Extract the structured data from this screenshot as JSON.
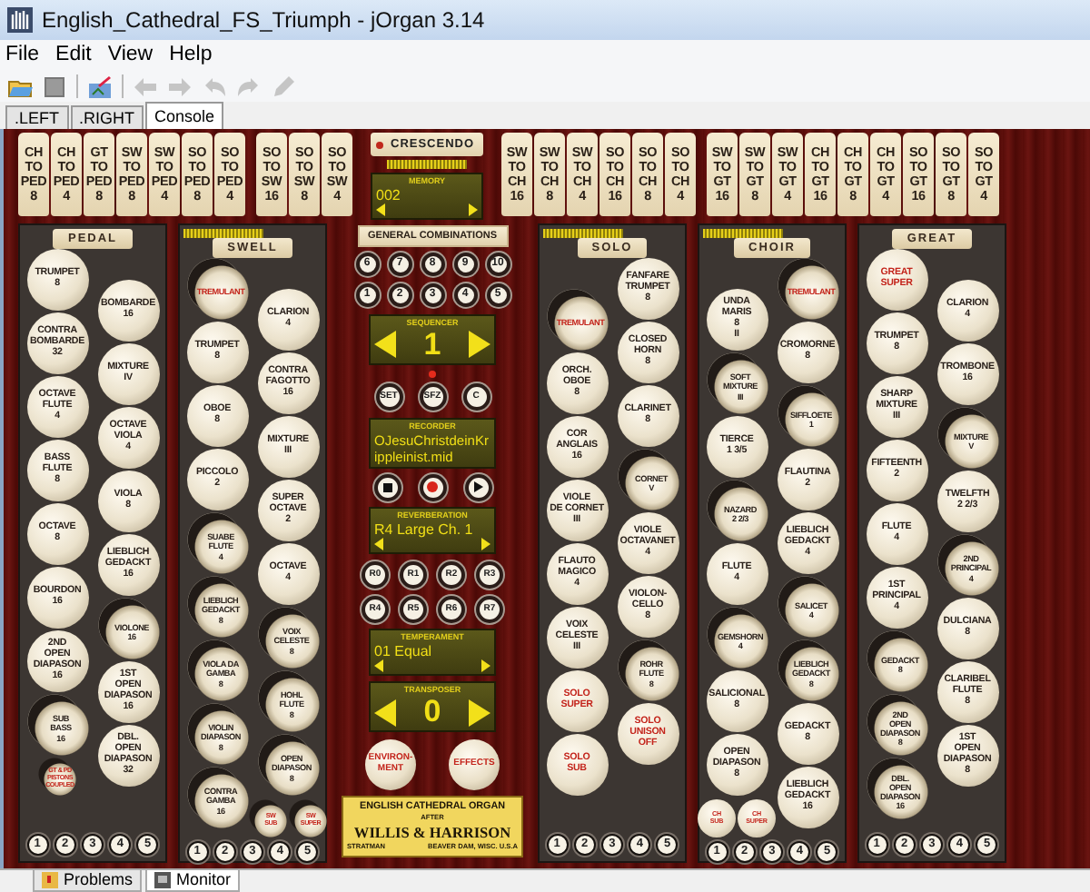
{
  "window": {
    "title": "English_Cathedral_FS_Triumph - jOrgan 3.14"
  },
  "menu": [
    "File",
    "Edit",
    "View",
    "Help"
  ],
  "toolbar": [
    {
      "disabled": false
    },
    {
      "disabled": false
    },
    {
      "disabled": false
    },
    {
      "disabled": true
    },
    {
      "disabled": true
    },
    {
      "disabled": true
    },
    {
      "disabled": true
    },
    {
      "disabled": true
    }
  ],
  "tabs": [
    {
      "label": ".LEFT",
      "selected": false
    },
    {
      "label": ".RIGHT",
      "selected": false
    },
    {
      "label": "Console",
      "selected": true
    }
  ],
  "couplers_left": [
    [
      {
        "lines": [
          "CH",
          "TO",
          "PED",
          "8"
        ]
      },
      {
        "lines": [
          "CH",
          "TO",
          "PED",
          "4"
        ]
      },
      {
        "lines": [
          "GT",
          "TO",
          "PED",
          "8"
        ]
      },
      {
        "lines": [
          "SW",
          "TO",
          "PED",
          "8"
        ]
      },
      {
        "lines": [
          "SW",
          "TO",
          "PED",
          "4"
        ]
      },
      {
        "lines": [
          "SO",
          "TO",
          "PED",
          "8"
        ]
      },
      {
        "lines": [
          "SO",
          "TO",
          "PED",
          "4"
        ]
      }
    ],
    [
      {
        "lines": [
          "SO",
          "TO",
          "SW",
          "16"
        ]
      },
      {
        "lines": [
          "SO",
          "TO",
          "SW",
          "8"
        ]
      },
      {
        "lines": [
          "SO",
          "TO",
          "SW",
          "4"
        ]
      }
    ]
  ],
  "crescendo": {
    "label": "CRESCENDO"
  },
  "memory": {
    "title": "MEMORY",
    "value": "002"
  },
  "couplers_right": [
    [
      {
        "lines": [
          "SW",
          "TO",
          "CH",
          "16"
        ]
      },
      {
        "lines": [
          "SW",
          "TO",
          "CH",
          "8"
        ]
      },
      {
        "lines": [
          "SW",
          "TO",
          "CH",
          "4"
        ]
      },
      {
        "lines": [
          "SO",
          "TO",
          "CH",
          "16"
        ]
      },
      {
        "lines": [
          "SO",
          "TO",
          "CH",
          "8"
        ]
      },
      {
        "lines": [
          "SO",
          "TO",
          "CH",
          "4"
        ]
      }
    ],
    [
      {
        "lines": [
          "SW",
          "TO",
          "GT",
          "16"
        ]
      },
      {
        "lines": [
          "SW",
          "TO",
          "GT",
          "8"
        ]
      },
      {
        "lines": [
          "SW",
          "TO",
          "GT",
          "4"
        ]
      },
      {
        "lines": [
          "CH",
          "TO",
          "GT",
          "16"
        ]
      },
      {
        "lines": [
          "CH",
          "TO",
          "GT",
          "8"
        ]
      },
      {
        "lines": [
          "CH",
          "TO",
          "GT",
          "4"
        ]
      },
      {
        "lines": [
          "SO",
          "TO",
          "GT",
          "16"
        ]
      },
      {
        "lines": [
          "SO",
          "TO",
          "GT",
          "8"
        ]
      },
      {
        "lines": [
          "SO",
          "TO",
          "GT",
          "4"
        ]
      }
    ]
  ],
  "left_divisions": [
    {
      "name": "PEDAL",
      "columns": [
        [
          {
            "kind": "stop",
            "lines": [
              "TRUMPET",
              "8"
            ],
            "on": false
          },
          {
            "kind": "stop",
            "lines": [
              "CONTRA",
              "BOMBARDE",
              "32"
            ],
            "on": false
          },
          {
            "kind": "stop",
            "lines": [
              "OCTAVE",
              "FLUTE",
              "4"
            ],
            "on": false
          },
          {
            "kind": "stop",
            "lines": [
              "BASS",
              "FLUTE",
              "8"
            ],
            "on": false
          },
          {
            "kind": "stop",
            "lines": [
              "OCTAVE",
              "8"
            ],
            "on": false
          },
          {
            "kind": "stop",
            "lines": [
              "BOURDON",
              "16"
            ],
            "on": false
          },
          {
            "kind": "stop",
            "lines": [
              "2ND",
              "OPEN",
              "DIAPASON",
              "16"
            ],
            "on": false
          },
          {
            "kind": "stop",
            "lines": [
              "SUB",
              "BASS",
              "16"
            ],
            "on": true
          },
          {
            "kind": "small",
            "lines": [
              "GT & PD",
              "PISTONS",
              "COUPLED"
            ],
            "on": true
          }
        ],
        [
          {
            "kind": "stop",
            "lines": [
              "BOMBARDE",
              "16"
            ],
            "on": false
          },
          {
            "kind": "stop",
            "lines": [
              "MIXTURE",
              "IV"
            ],
            "on": false
          },
          {
            "kind": "stop",
            "lines": [
              "OCTAVE",
              "VIOLA",
              "4"
            ],
            "on": false
          },
          {
            "kind": "stop",
            "lines": [
              "VIOLA",
              "8"
            ],
            "on": false
          },
          {
            "kind": "stop",
            "lines": [
              "LIEBLICH",
              "GEDACKT",
              "16"
            ],
            "on": false
          },
          {
            "kind": "stop",
            "lines": [
              "VIOLONE",
              "16"
            ],
            "on": true
          },
          {
            "kind": "stop",
            "lines": [
              "1ST",
              "OPEN",
              "DIAPASON",
              "16"
            ],
            "on": false
          },
          {
            "kind": "stop",
            "lines": [
              "DBL.",
              "OPEN",
              "DIAPASON",
              "32"
            ],
            "on": false
          }
        ]
      ],
      "pistons": [
        "1",
        "2",
        "3",
        "4",
        "5"
      ]
    },
    {
      "name": "SWELL",
      "expression_meter": true,
      "columns": [
        [
          {
            "kind": "accessory",
            "lines": [
              "TREMULANT"
            ],
            "on": true
          },
          {
            "kind": "stop",
            "lines": [
              "TRUMPET",
              "8"
            ],
            "on": false
          },
          {
            "kind": "stop",
            "lines": [
              "OBOE",
              "8"
            ],
            "on": false
          },
          {
            "kind": "stop",
            "lines": [
              "PICCOLO",
              "2"
            ],
            "on": false
          },
          {
            "kind": "stop",
            "lines": [
              "SUABE",
              "FLUTE",
              "4"
            ],
            "on": true
          },
          {
            "kind": "stop",
            "lines": [
              "LIEBLICH",
              "GEDACKT",
              "8"
            ],
            "on": true
          },
          {
            "kind": "stop",
            "lines": [
              "VIOLA DA",
              "GAMBA",
              "8"
            ],
            "on": true
          },
          {
            "kind": "stop",
            "lines": [
              "VIOLIN",
              "DIAPASON",
              "8"
            ],
            "on": true
          },
          {
            "kind": "stop",
            "lines": [
              "CONTRA",
              "GAMBA",
              "16"
            ],
            "on": true
          }
        ],
        [
          {
            "kind": "stop",
            "lines": [
              "CLARION",
              "4"
            ],
            "on": false
          },
          {
            "kind": "stop",
            "lines": [
              "CONTRA",
              "FAGOTTO",
              "16"
            ],
            "on": false
          },
          {
            "kind": "stop",
            "lines": [
              "MIXTURE",
              "III"
            ],
            "on": false
          },
          {
            "kind": "stop",
            "lines": [
              "SUPER",
              "OCTAVE",
              "2"
            ],
            "on": false
          },
          {
            "kind": "stop",
            "lines": [
              "OCTAVE",
              "4"
            ],
            "on": false
          },
          {
            "kind": "stop",
            "lines": [
              "VOIX",
              "CELESTE",
              "8"
            ],
            "on": true
          },
          {
            "kind": "stop",
            "lines": [
              "HOHL",
              "FLUTE",
              "8"
            ],
            "on": true
          },
          {
            "kind": "stop",
            "lines": [
              "OPEN",
              "DIAPASON",
              "8"
            ],
            "on": true
          }
        ]
      ],
      "footer": [
        {
          "kind": "small",
          "lines": [
            "SW",
            "SUB"
          ],
          "on": true
        },
        {
          "kind": "small",
          "lines": [
            "SW",
            "SUPER"
          ],
          "on": true
        }
      ],
      "pistons": [
        "1",
        "2",
        "3",
        "4",
        "5"
      ]
    }
  ],
  "general": {
    "title": "GENERAL COMBINATIONS",
    "piston_rows": [
      [
        "6",
        "7",
        "8",
        "9",
        "10"
      ],
      [
        "1",
        "2",
        "3",
        "4",
        "5"
      ]
    ],
    "sequencer": {
      "title": "SEQUENCER",
      "value": "1"
    },
    "set_buttons": [
      "SET",
      "SFZ",
      "C"
    ],
    "recorder": {
      "title": "RECORDER",
      "file": "OJesuChristdeinKrippleinist.mid"
    },
    "reverberation": {
      "title": "REVERBERATION",
      "value": "R4 Large Ch. 1"
    },
    "reverb_buttons": [
      [
        "R0",
        "R1",
        "R2",
        "R3"
      ],
      [
        "R4",
        "R5",
        "R6",
        "R7"
      ]
    ],
    "temperament": {
      "title": "TEMPERAMENT",
      "value": "01 Equal"
    },
    "transposer": {
      "title": "TRANSPOSER",
      "value": "0"
    },
    "knobs": [
      {
        "lines": [
          "ENVIRON-",
          "MENT"
        ]
      },
      {
        "lines": [
          "EFFECTS"
        ]
      }
    ],
    "nameplate": {
      "heading": "ENGLISH CATHEDRAL ORGAN",
      "after": "AFTER",
      "builders": "WILLIS & HARRISON",
      "author": "STRATMAN",
      "place": "BEAVER DAM, WISC. U.S.A"
    }
  },
  "right_divisions": [
    {
      "name": "SOLO",
      "expression_meter": true,
      "columns": [
        [
          {
            "kind": "accessory",
            "lines": [
              "TREMULANT"
            ],
            "on": true
          },
          {
            "kind": "stop",
            "lines": [
              "ORCH.",
              "OBOE",
              "8"
            ],
            "on": false
          },
          {
            "kind": "stop",
            "lines": [
              "COR",
              "ANGLAIS",
              "16"
            ],
            "on": false
          },
          {
            "kind": "stop",
            "lines": [
              "VIOLE",
              "DE CORNET",
              "III"
            ],
            "on": false
          },
          {
            "kind": "stop",
            "lines": [
              "FLAUTO",
              "MAGICO",
              "4"
            ],
            "on": false
          },
          {
            "kind": "stop",
            "lines": [
              "VOIX",
              "CELESTE",
              "III"
            ],
            "on": false
          },
          {
            "kind": "accessory",
            "lines": [
              "SOLO",
              "SUPER"
            ],
            "on": false
          },
          {
            "kind": "accessory",
            "lines": [
              "SOLO",
              "SUB"
            ],
            "on": false
          }
        ],
        [
          {
            "kind": "stop",
            "lines": [
              "FANFARE",
              "TRUMPET",
              "8"
            ],
            "on": false
          },
          {
            "kind": "stop",
            "lines": [
              "CLOSED",
              "HORN",
              "8"
            ],
            "on": false
          },
          {
            "kind": "stop",
            "lines": [
              "CLARINET",
              "8"
            ],
            "on": false
          },
          {
            "kind": "stop",
            "lines": [
              "CORNET",
              "V"
            ],
            "on": true
          },
          {
            "kind": "stop",
            "lines": [
              "VIOLE",
              "OCTAVANET",
              "4"
            ],
            "on": false
          },
          {
            "kind": "stop",
            "lines": [
              "VIOLON-",
              "CELLO",
              "8"
            ],
            "on": false
          },
          {
            "kind": "stop",
            "lines": [
              "ROHR",
              "FLUTE",
              "8"
            ],
            "on": true
          },
          {
            "kind": "accessory",
            "lines": [
              "SOLO",
              "UNISON",
              "OFF"
            ],
            "on": false
          }
        ]
      ],
      "pistons": [
        "1",
        "2",
        "3",
        "4",
        "5"
      ]
    },
    {
      "name": "CHOIR",
      "expression_meter": true,
      "columns": [
        [
          {
            "kind": "stop",
            "lines": [
              "UNDA",
              "MARIS",
              "8",
              "II"
            ],
            "on": false
          },
          {
            "kind": "stop",
            "lines": [
              "SOFT",
              "MIXTURE",
              "III"
            ],
            "on": true
          },
          {
            "kind": "stop",
            "lines": [
              "TIERCE",
              "1 3/5"
            ],
            "on": false
          },
          {
            "kind": "stop",
            "lines": [
              "NAZARD",
              "2 2/3"
            ],
            "on": true
          },
          {
            "kind": "stop",
            "lines": [
              "FLUTE",
              "4"
            ],
            "on": false
          },
          {
            "kind": "stop",
            "lines": [
              "GEMSHORN",
              "4"
            ],
            "on": true
          },
          {
            "kind": "stop",
            "lines": [
              "SALICIONAL",
              "8"
            ],
            "on": false
          },
          {
            "kind": "stop",
            "lines": [
              "OPEN",
              "DIAPASON",
              "8"
            ],
            "on": false
          }
        ],
        [
          {
            "kind": "accessory",
            "lines": [
              "TREMULANT"
            ],
            "on": true
          },
          {
            "kind": "stop",
            "lines": [
              "CROMORNE",
              "8"
            ],
            "on": false
          },
          {
            "kind": "stop",
            "lines": [
              "SIFFLOETE",
              "1"
            ],
            "on": true
          },
          {
            "kind": "stop",
            "lines": [
              "FLAUTINA",
              "2"
            ],
            "on": false
          },
          {
            "kind": "stop",
            "lines": [
              "LIEBLICH",
              "GEDACKT",
              "4"
            ],
            "on": false
          },
          {
            "kind": "stop",
            "lines": [
              "SALICET",
              "4"
            ],
            "on": true
          },
          {
            "kind": "stop",
            "lines": [
              "LIEBLICH",
              "GEDACKT",
              "8"
            ],
            "on": true
          },
          {
            "kind": "stop",
            "lines": [
              "GEDACKT",
              "8"
            ],
            "on": false
          },
          {
            "kind": "stop",
            "lines": [
              "LIEBLICH",
              "GEDACKT",
              "16"
            ],
            "on": false
          }
        ]
      ],
      "footer": [
        {
          "kind": "small",
          "lines": [
            "CH",
            "SUB"
          ],
          "on": false
        },
        {
          "kind": "small",
          "lines": [
            "CH",
            "SUPER"
          ],
          "on": false
        }
      ],
      "pistons": [
        "1",
        "2",
        "3",
        "4",
        "5"
      ]
    },
    {
      "name": "GREAT",
      "columns": [
        [
          {
            "kind": "accessory",
            "lines": [
              "GREAT",
              "SUPER"
            ],
            "on": false
          },
          {
            "kind": "stop",
            "lines": [
              "TRUMPET",
              "8"
            ],
            "on": false
          },
          {
            "kind": "stop",
            "lines": [
              "SHARP",
              "MIXTURE",
              "III"
            ],
            "on": false
          },
          {
            "kind": "stop",
            "lines": [
              "FIFTEENTH",
              "2"
            ],
            "on": false
          },
          {
            "kind": "stop",
            "lines": [
              "FLUTE",
              "4"
            ],
            "on": false
          },
          {
            "kind": "stop",
            "lines": [
              "1ST",
              "PRINCIPAL",
              "4"
            ],
            "on": false
          },
          {
            "kind": "stop",
            "lines": [
              "GEDACKT",
              "8"
            ],
            "on": true
          },
          {
            "kind": "stop",
            "lines": [
              "2ND",
              "OPEN",
              "DIAPASON",
              "8"
            ],
            "on": true
          },
          {
            "kind": "stop",
            "lines": [
              "DBL.",
              "OPEN",
              "DIAPASON",
              "16"
            ],
            "on": true
          }
        ],
        [
          {
            "kind": "stop",
            "lines": [
              "CLARION",
              "4"
            ],
            "on": false
          },
          {
            "kind": "stop",
            "lines": [
              "TROMBONE",
              "16"
            ],
            "on": false
          },
          {
            "kind": "stop",
            "lines": [
              "MIXTURE",
              "V"
            ],
            "on": true
          },
          {
            "kind": "stop",
            "lines": [
              "TWELFTH",
              "2 2/3"
            ],
            "on": false
          },
          {
            "kind": "stop",
            "lines": [
              "2ND",
              "PRINCIPAL",
              "4"
            ],
            "on": true
          },
          {
            "kind": "stop",
            "lines": [
              "DULCIANA",
              "8"
            ],
            "on": false
          },
          {
            "kind": "stop",
            "lines": [
              "CLARIBEL",
              "FLUTE",
              "8"
            ],
            "on": false
          },
          {
            "kind": "stop",
            "lines": [
              "1ST",
              "OPEN",
              "DIAPASON",
              "8"
            ],
            "on": false
          }
        ]
      ],
      "pistons": [
        "1",
        "2",
        "3",
        "4",
        "5"
      ]
    }
  ],
  "bottom_tabs": [
    {
      "label": "Problems",
      "selected": false
    },
    {
      "label": "Monitor",
      "selected": true
    }
  ]
}
